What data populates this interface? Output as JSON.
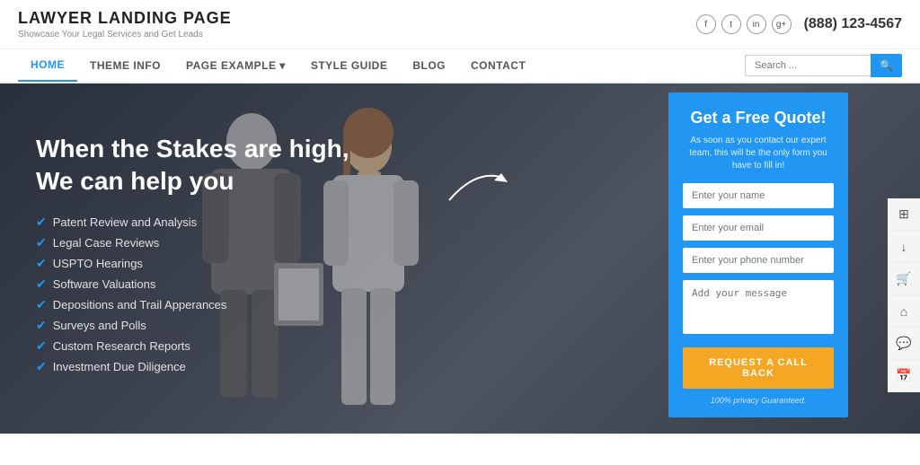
{
  "header": {
    "logo_title": "LAWYER LANDING PAGE",
    "logo_sub": "Showcase Your Legal Services and Get Leads",
    "phone": "(888) 123-4567",
    "social": [
      "f",
      "t",
      "in",
      "g+"
    ]
  },
  "nav": {
    "links": [
      {
        "label": "HOME",
        "active": true
      },
      {
        "label": "THEME INFO",
        "active": false
      },
      {
        "label": "PAGE EXAMPLE ▾",
        "active": false
      },
      {
        "label": "STYLE GUIDE",
        "active": false
      },
      {
        "label": "BLOG",
        "active": false
      },
      {
        "label": "CONTACT",
        "active": false
      }
    ],
    "search_placeholder": "Search ..."
  },
  "hero": {
    "title_line1": "When the Stakes are high,",
    "title_line2": "We can help you",
    "services": [
      "Patent Review and Analysis",
      "Legal Case Reviews",
      "USPTO Hearings",
      "Software Valuations",
      "Depositions and Trail Apperances",
      "Surveys and Polls",
      "Custom Research Reports",
      "Investment Due Diligence"
    ]
  },
  "quote_form": {
    "title": "Get a Free Quote!",
    "subtitle": "As soon as you contact our expert team, this will be the only form you have to fill in!",
    "name_placeholder": "Enter your name",
    "email_placeholder": "Enter your email",
    "phone_placeholder": "Enter your phone number",
    "message_placeholder": "Add your message",
    "cta_label": "REQUEST A CALL BACK",
    "privacy_text": "100% privacy Guaranteed."
  },
  "sidebar_icons": [
    "grid",
    "download",
    "cart",
    "tag",
    "chat",
    "calendar"
  ]
}
